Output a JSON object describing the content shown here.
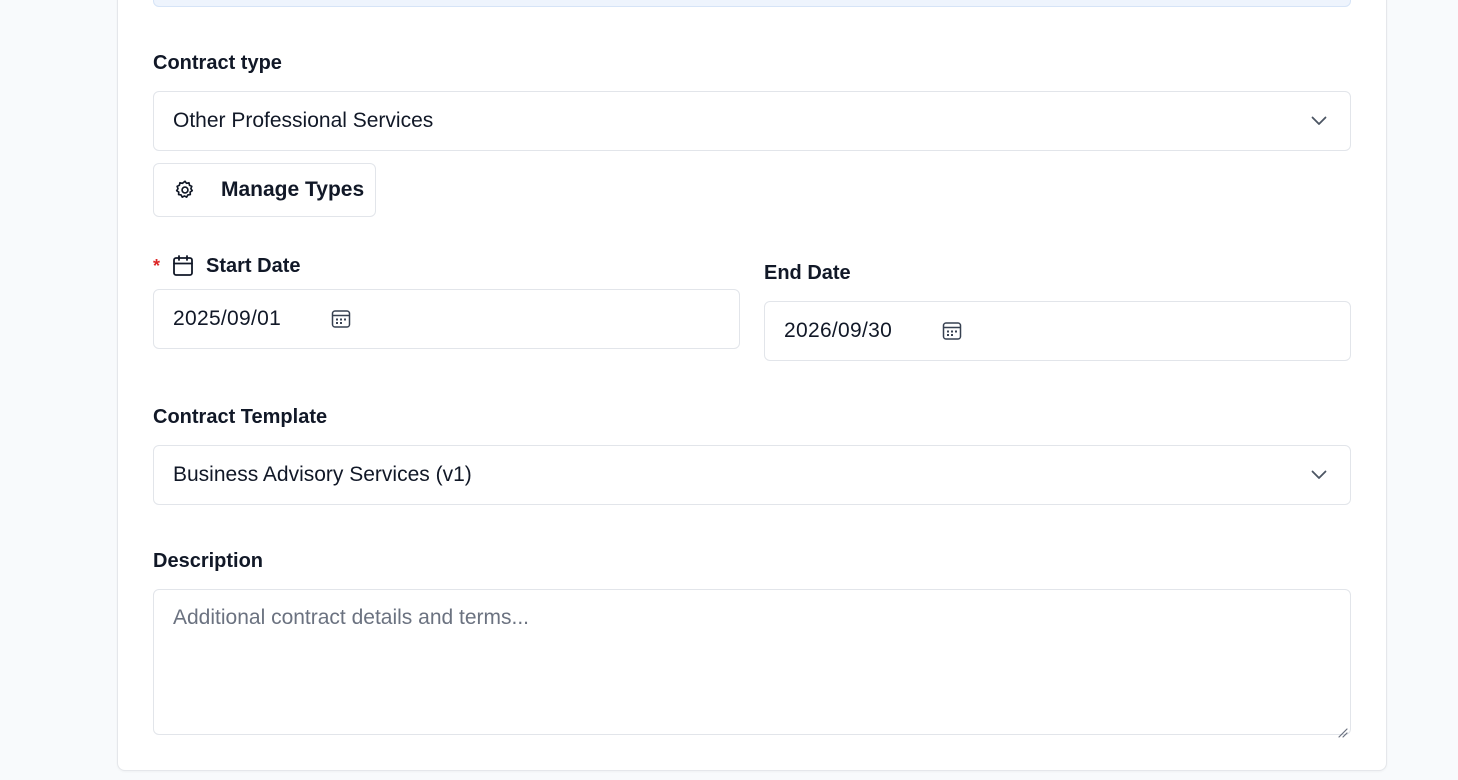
{
  "contract_type": {
    "label": "Contract type",
    "selected": "Other Professional Services",
    "icon": "chevron-down-icon"
  },
  "manage_types_button": {
    "label": "Manage Types",
    "icon": "gear-icon"
  },
  "start_date": {
    "required_marker": "*",
    "label": "Start Date",
    "label_icon": "calendar-icon",
    "value": "2025/09/01",
    "picker_icon": "calendar-grid-icon"
  },
  "end_date": {
    "label": "End Date",
    "value": "2026/09/30",
    "picker_icon": "calendar-grid-icon"
  },
  "contract_template": {
    "label": "Contract Template",
    "selected": "Business Advisory Services (v1)",
    "icon": "chevron-down-icon"
  },
  "description": {
    "label": "Description",
    "placeholder": "Additional contract details and terms..."
  },
  "colors": {
    "required": "#dc2626",
    "border": "#e2e5ea",
    "info_strip": "#eef4fd",
    "page_bg": "#f8fafc"
  }
}
